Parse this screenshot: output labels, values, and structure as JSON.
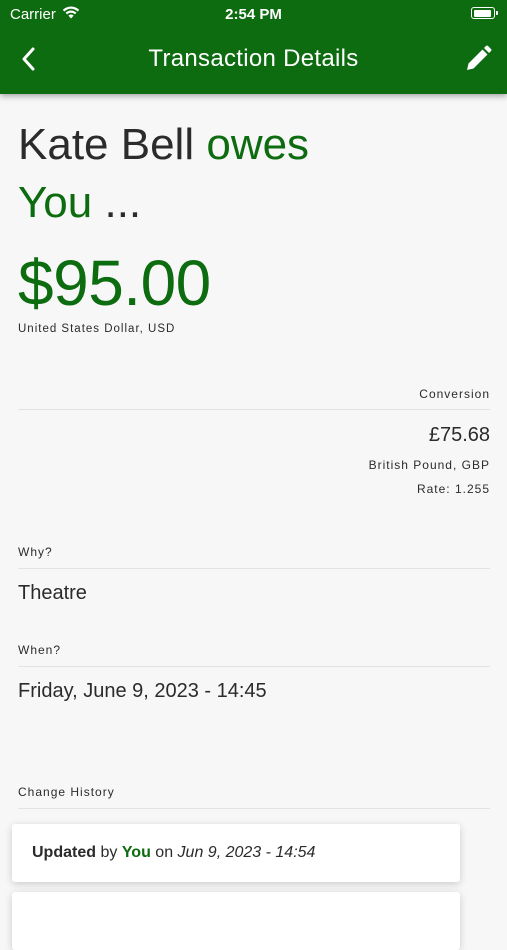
{
  "status_bar": {
    "carrier": "Carrier",
    "time": "2:54 PM",
    "battery_level": 0.9
  },
  "nav": {
    "title": "Transaction Details",
    "back_icon": "chevron-left-icon",
    "edit_icon": "pencil-icon"
  },
  "headline": {
    "name": "Kate Bell",
    "verb": "owes",
    "target": "You",
    "ellipsis": "..."
  },
  "amount": {
    "value": "$95.00",
    "currency": "United States Dollar, USD"
  },
  "conversion": {
    "label": "Conversion",
    "amount": "£75.68",
    "currency": "British Pound, GBP",
    "rate": "Rate: 1.255"
  },
  "why": {
    "label": "Why?",
    "value": "Theatre"
  },
  "when": {
    "label": "When?",
    "value": "Friday, June 9, 2023 - 14:45"
  },
  "history": {
    "label": "Change History",
    "entries": [
      {
        "action": "Updated",
        "by": "by",
        "user": "You",
        "on": "on",
        "date": "Jun 9, 2023 - 14:54"
      }
    ]
  },
  "colors": {
    "brand": "#0d6b10",
    "text": "#2b2b2b",
    "background": "#f7f7f7"
  }
}
